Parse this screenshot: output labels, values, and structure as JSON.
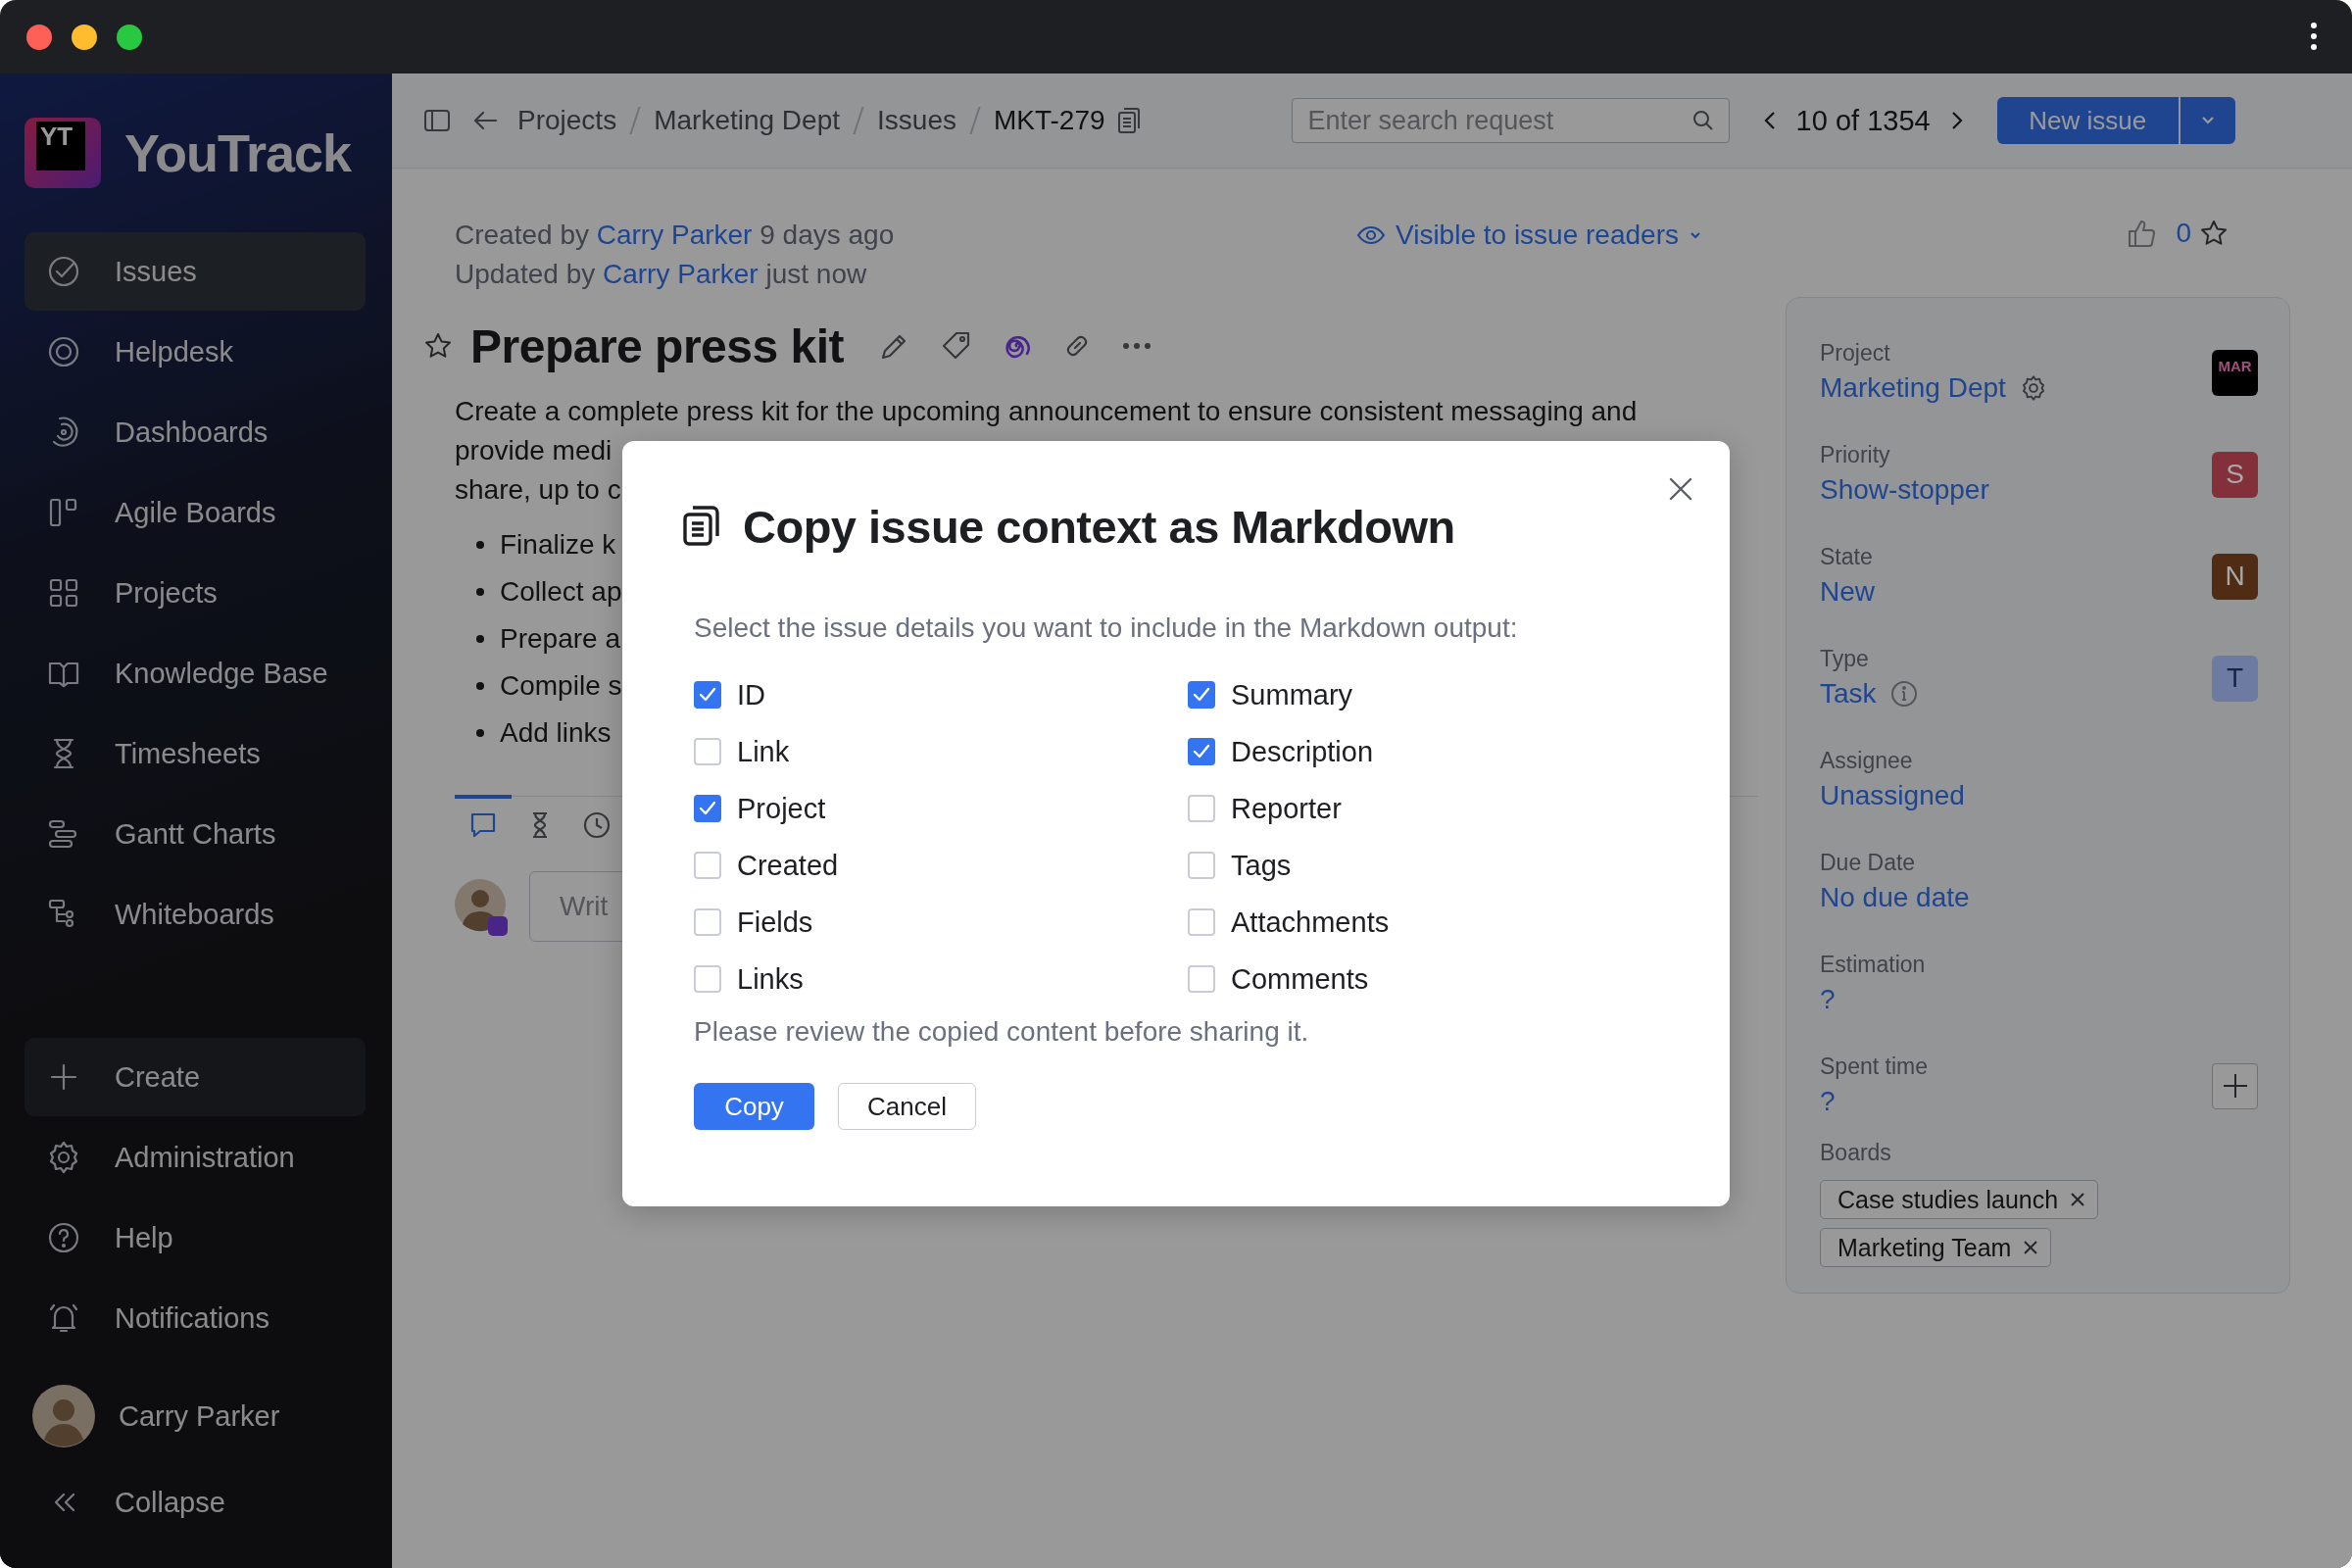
{
  "sidebar": {
    "logo": {
      "badge": "YT",
      "name": "YouTrack"
    },
    "items": [
      {
        "label": "Issues",
        "selected": true
      },
      {
        "label": "Helpdesk",
        "selected": false
      },
      {
        "label": "Dashboards",
        "selected": false
      },
      {
        "label": "Agile Boards",
        "selected": false
      },
      {
        "label": "Projects",
        "selected": false
      },
      {
        "label": "Knowledge Base",
        "selected": false
      },
      {
        "label": "Timesheets",
        "selected": false
      },
      {
        "label": "Gantt Charts",
        "selected": false
      },
      {
        "label": "Whiteboards",
        "selected": false
      }
    ],
    "create": "Create",
    "bottom_items": [
      {
        "label": "Administration"
      },
      {
        "label": "Help"
      },
      {
        "label": "Notifications"
      }
    ],
    "user": "Carry Parker",
    "collapse": "Collapse"
  },
  "topbar": {
    "breadcrumbs": [
      "Projects",
      "Marketing Dept",
      "Issues"
    ],
    "issue_id": "MKT-279",
    "search": {
      "placeholder": "Enter search request"
    },
    "pager": "10 of 1354",
    "new_issue": "New issue"
  },
  "issue": {
    "created": {
      "prefix": "Created by",
      "author": "Carry Parker",
      "suffix": "9 days ago"
    },
    "updated": {
      "prefix": "Updated by",
      "author": "Carry Parker",
      "suffix": "just now"
    },
    "visibility": "Visible to issue readers",
    "votes": "0",
    "title": "Prepare press kit",
    "description": [
      "Create a complete press kit for the upcoming announcement to ensure consistent messaging and",
      "provide medi",
      "share, up to c"
    ],
    "bullets": [
      "Finalize k",
      "Collect ap",
      "Prepare a",
      "Compile s",
      "Add links"
    ],
    "activity_tabs": [
      {
        "selected": true
      },
      {
        "selected": false
      },
      {
        "selected": false
      }
    ],
    "comment": {
      "placeholder": "Writ"
    }
  },
  "fields": [
    {
      "label": "Project",
      "value": "Marketing Dept",
      "kind": "setting",
      "badge": {
        "text": "MAR",
        "color": "#000000"
      }
    },
    {
      "label": "Priority",
      "value": "Show-stopper",
      "kind": "plain",
      "badge": {
        "text": "S",
        "color": "#84303a"
      }
    },
    {
      "label": "State",
      "value": "New",
      "kind": "plain",
      "badge": {
        "text": "N",
        "color": "#512c14"
      }
    },
    {
      "label": "Type",
      "value": "Task",
      "kind": "info",
      "badge": {
        "text": "T",
        "color": "#6d7ba3"
      }
    },
    {
      "label": "Assignee",
      "value": "Unassigned",
      "kind": "plain"
    },
    {
      "label": "Due Date",
      "value": "No due date",
      "kind": "plain"
    },
    {
      "label": "Estimation",
      "value": "?",
      "kind": "plain"
    },
    {
      "label": "Spent time",
      "value": "?",
      "kind": "add"
    }
  ],
  "boards": {
    "label": "Boards",
    "tags": [
      "Case studies launch",
      "Marketing Team"
    ]
  },
  "dialog": {
    "title": "Copy issue context as Markdown",
    "prompt": "Select the issue details you want to include in the Markdown output:",
    "options": [
      {
        "label": "ID",
        "checked": true
      },
      {
        "label": "Summary",
        "checked": true
      },
      {
        "label": "Link",
        "checked": false
      },
      {
        "label": "Description",
        "checked": true
      },
      {
        "label": "Project",
        "checked": true
      },
      {
        "label": "Reporter",
        "checked": false
      },
      {
        "label": "Created",
        "checked": false
      },
      {
        "label": "Tags",
        "checked": false
      },
      {
        "label": "Fields",
        "checked": false
      },
      {
        "label": "Attachments",
        "checked": false
      },
      {
        "label": "Links",
        "checked": false
      },
      {
        "label": "Comments",
        "checked": false
      }
    ],
    "note": "Please review the copied content before sharing it.",
    "copy": "Copy",
    "cancel": "Cancel"
  }
}
